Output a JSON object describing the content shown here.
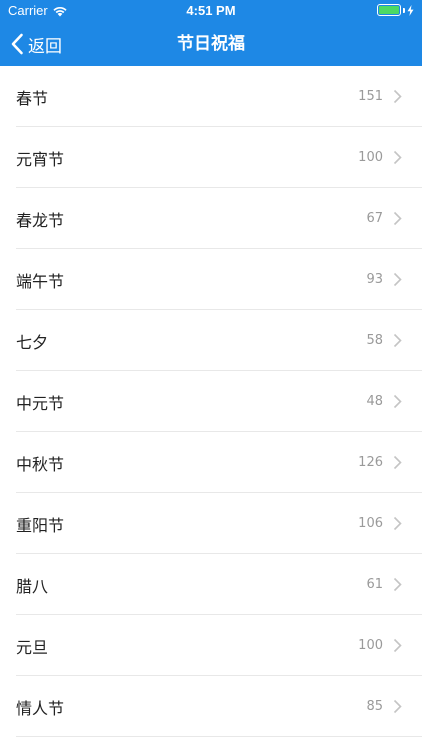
{
  "status_bar": {
    "carrier": "Carrier",
    "time": "4:51 PM"
  },
  "nav": {
    "back_label": "返回",
    "title": "节日祝福"
  },
  "colors": {
    "header_bg": "#1e88e5",
    "battery": "#4cd964"
  },
  "icons": {
    "wifi": "wifi-icon",
    "battery": "battery-icon",
    "charging": "charging-bolt-icon",
    "back": "chevron-left-icon",
    "disclosure": "chevron-right-icon"
  },
  "items": [
    {
      "label": "春节",
      "count": "151"
    },
    {
      "label": "元宵节",
      "count": "100"
    },
    {
      "label": "春龙节",
      "count": "67"
    },
    {
      "label": "端午节",
      "count": "93"
    },
    {
      "label": "七夕",
      "count": "58"
    },
    {
      "label": "中元节",
      "count": "48"
    },
    {
      "label": "中秋节",
      "count": "126"
    },
    {
      "label": "重阳节",
      "count": "106"
    },
    {
      "label": "腊八",
      "count": "61"
    },
    {
      "label": "元旦",
      "count": "100"
    },
    {
      "label": "情人节",
      "count": "85"
    }
  ]
}
